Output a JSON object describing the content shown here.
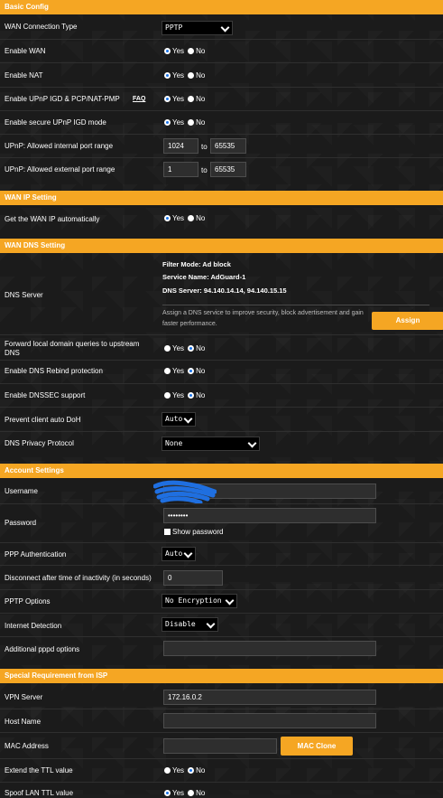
{
  "sections": {
    "basic": "Basic Config",
    "wan_ip": "WAN IP Setting",
    "wan_dns": "WAN DNS Setting",
    "account": "Account Settings",
    "isp": "Special Requirement from ISP"
  },
  "radio": {
    "yes": "Yes",
    "no": "No"
  },
  "basic": {
    "wan_type": {
      "label": "WAN Connection Type",
      "value": "PPTP"
    },
    "enable_wan": {
      "label": "Enable WAN",
      "value": "Yes"
    },
    "enable_nat": {
      "label": "Enable NAT",
      "value": "Yes"
    },
    "upnp": {
      "label": "Enable UPnP IGD & PCP/NAT-PMP",
      "faq": "FAQ",
      "value": "Yes"
    },
    "secure_upnp": {
      "label": "Enable secure UPnP IGD mode",
      "value": "Yes"
    },
    "int_range": {
      "label": "UPnP: Allowed internal port range",
      "from": "1024",
      "to_label": "to",
      "to": "65535"
    },
    "ext_range": {
      "label": "UPnP: Allowed external port range",
      "from": "1",
      "to_label": "to",
      "to": "65535"
    }
  },
  "wan_ip": {
    "auto": {
      "label": "Get the WAN IP automatically",
      "value": "Yes"
    }
  },
  "dns": {
    "server_label": "DNS Server",
    "filter_mode": "Filter Mode: Ad block",
    "service_name": "Service Name: AdGuard-1",
    "dns_server": "DNS Server: 94.140.14.14, 94.140.15.15",
    "description": "Assign a DNS service to improve security, block advertisement and gain faster performance.",
    "assign": "Assign",
    "forward": {
      "label": "Forward local domain queries to upstream DNS",
      "value": "No"
    },
    "rebind": {
      "label": "Enable DNS Rebind protection",
      "value": "No"
    },
    "dnssec": {
      "label": "Enable DNSSEC support",
      "value": "No"
    },
    "doh": {
      "label": "Prevent client auto DoH",
      "value": "Auto"
    },
    "privacy": {
      "label": "DNS Privacy Protocol",
      "value": "None"
    }
  },
  "account": {
    "username": {
      "label": "Username",
      "value": ""
    },
    "password": {
      "label": "Password",
      "value": "••••••••",
      "show": "Show password"
    },
    "ppp_auth": {
      "label": "PPP Authentication",
      "value": "Auto"
    },
    "idle": {
      "label": "Disconnect after time of inactivity (in seconds)",
      "value": "0"
    },
    "pptp": {
      "label": "PPTP Options",
      "value": "No Encryption"
    },
    "detect": {
      "label": "Internet Detection",
      "value": "Disable"
    },
    "pppd": {
      "label": "Additional pppd options",
      "value": ""
    }
  },
  "isp": {
    "vpn": {
      "label": "VPN Server",
      "value": "172.16.0.2"
    },
    "host": {
      "label": "Host Name",
      "value": ""
    },
    "mac": {
      "label": "MAC Address",
      "value": "",
      "button": "MAC Clone"
    },
    "ttl": {
      "label": "Extend the TTL value",
      "value": "No"
    },
    "spoof": {
      "label": "Spoof LAN TTL value",
      "value": "Yes"
    }
  },
  "colors": {
    "accent": "#f5a623",
    "radio_on": "#1a73e8",
    "scribble": "#1f6fe0"
  },
  "icons": {
    "select_arrow": "chevron-down-icon"
  }
}
